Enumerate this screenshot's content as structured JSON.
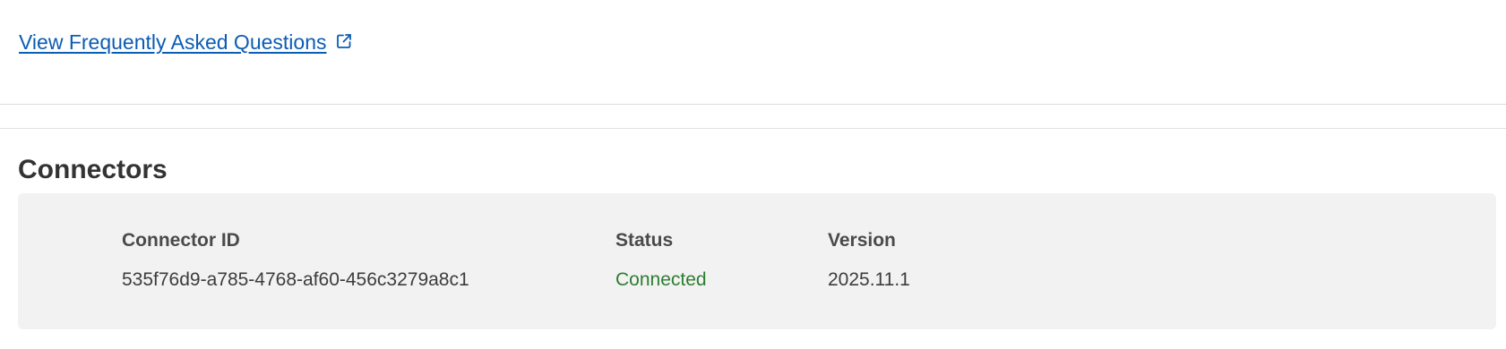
{
  "faq": {
    "link_label": "View Frequently Asked Questions",
    "icon": "external-link-icon"
  },
  "connectors": {
    "title": "Connectors",
    "columns": {
      "id": "Connector ID",
      "status": "Status",
      "version": "Version"
    },
    "rows": [
      {
        "id": "535f76d9-a785-4768-af60-456c3279a8c1",
        "status": "Connected",
        "version": "2025.11.1"
      }
    ]
  },
  "colors": {
    "link": "#0b5cb5",
    "status_connected": "#2e7d32",
    "panel_background": "#f2f2f2"
  }
}
